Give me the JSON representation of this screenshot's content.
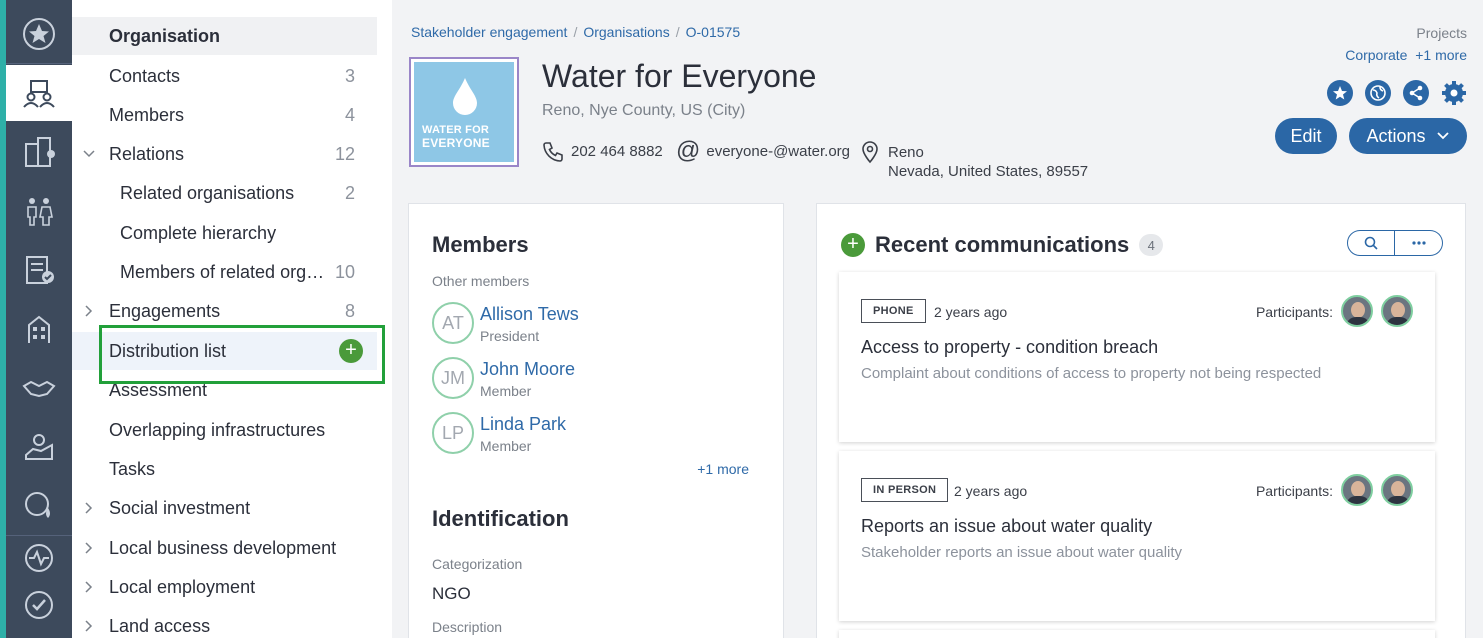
{
  "nav": {
    "items": [
      {
        "label": "Organisation",
        "count": ""
      },
      {
        "label": "Contacts",
        "count": "3"
      },
      {
        "label": "Members",
        "count": "4"
      },
      {
        "label": "Relations",
        "count": "12"
      },
      {
        "label": "Related organisations",
        "count": "2"
      },
      {
        "label": "Complete hierarchy",
        "count": ""
      },
      {
        "label": "Members of related org…",
        "count": "10"
      },
      {
        "label": "Engagements",
        "count": "8"
      },
      {
        "label": "Distribution list",
        "count": ""
      },
      {
        "label": "Assessment",
        "count": ""
      },
      {
        "label": "Overlapping infrastructures",
        "count": ""
      },
      {
        "label": "Tasks",
        "count": ""
      },
      {
        "label": "Social investment",
        "count": ""
      },
      {
        "label": "Local business development",
        "count": ""
      },
      {
        "label": "Local employment",
        "count": ""
      },
      {
        "label": "Land access",
        "count": ""
      }
    ],
    "plus_label": "+"
  },
  "breadcrumb": [
    "Stakeholder engagement",
    "Organisations",
    "O-01575"
  ],
  "breadcrumb_sep": "/",
  "projects": {
    "title": "Projects",
    "value": "Corporate",
    "more": "+1 more"
  },
  "org": {
    "logo_line1": "WATER FOR",
    "logo_line2": "EVERYONE",
    "title": "Water for Everyone",
    "subtitle": "Reno, Nye County, US (City)",
    "phone": "202 464 8882",
    "email": "everyone-@water.org",
    "address_line1": "Reno",
    "address_line2": "Nevada, United States, 89557"
  },
  "buttons": {
    "edit": "Edit",
    "actions": "Actions"
  },
  "members_card": {
    "title": "Members",
    "subtitle": "Other members",
    "members": [
      {
        "initials": "AT",
        "name": "Allison Tews",
        "role": "President"
      },
      {
        "initials": "JM",
        "name": "John Moore",
        "role": "Member"
      },
      {
        "initials": "LP",
        "name": "Linda Park",
        "role": "Member"
      }
    ],
    "more": "+1 more",
    "identification_title": "Identification",
    "categorization_label": "Categorization",
    "categorization_value": "NGO",
    "description_label": "Description"
  },
  "comms": {
    "plus_label": "+",
    "title": "Recent communications",
    "count": "4",
    "items": [
      {
        "type": "PHONE",
        "ago": "2 years ago",
        "participants_label": "Participants:",
        "subject": "Access to property - condition breach",
        "description": "Complaint about conditions of access to property not being respected"
      },
      {
        "type": "IN PERSON",
        "ago": "2 years ago",
        "participants_label": "Participants:",
        "subject": "Reports an issue about water quality",
        "description": "Stakeholder reports an issue about water quality"
      }
    ]
  },
  "colors": {
    "accent": "#2b67a6",
    "rail": "#3d4a5c",
    "teal": "#2eb0a8",
    "green": "#4a9a3a",
    "highlight_box": "#22a03a"
  }
}
